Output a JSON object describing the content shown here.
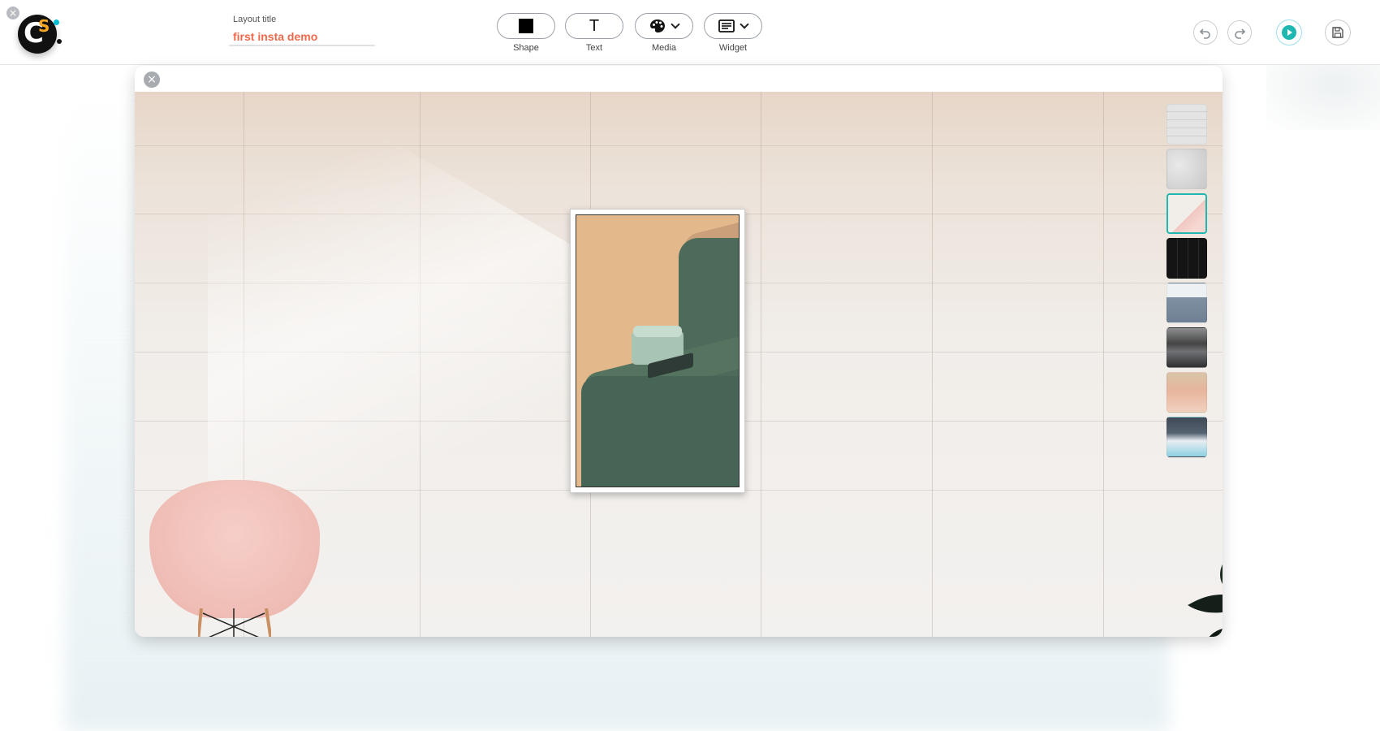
{
  "app": {
    "corner_close_icon": "close-icon",
    "logo_letters": {
      "c": "C",
      "s": "S"
    }
  },
  "header": {
    "title_label": "Layout title",
    "title_value": "first insta demo",
    "title_placeholder": "Layout title",
    "tools": [
      {
        "label": "Shape",
        "icon": "square-icon"
      },
      {
        "label": "Text",
        "glyph": "T",
        "icon": "text-icon"
      },
      {
        "label": "Media",
        "icon": "palette-icon"
      },
      {
        "label": "Widget",
        "icon": "widget-icon"
      }
    ],
    "actions": [
      "undo-icon",
      "redo-icon",
      "play-icon",
      "save-icon"
    ]
  },
  "canvas": {
    "close_glyph": "×",
    "background_thumbnails": [
      {
        "name": "white-brick",
        "color": "#dcdcdc"
      },
      {
        "name": "marble",
        "color": "#d3d3d3"
      },
      {
        "name": "pink-chair-room",
        "color": "#e8e4e0",
        "selected": true
      },
      {
        "name": "black-tiles",
        "color": "#1b1b1b"
      },
      {
        "name": "blue-sofa",
        "color": "#8c9aa8"
      },
      {
        "name": "kitchen",
        "color": "#56575a"
      },
      {
        "name": "peach-marble",
        "color": "#e0b39a"
      },
      {
        "name": "bedroom",
        "color": "#5b6b78"
      }
    ]
  },
  "colors": {
    "accent": "#1fb8b0",
    "title_text": "#f0694b"
  }
}
